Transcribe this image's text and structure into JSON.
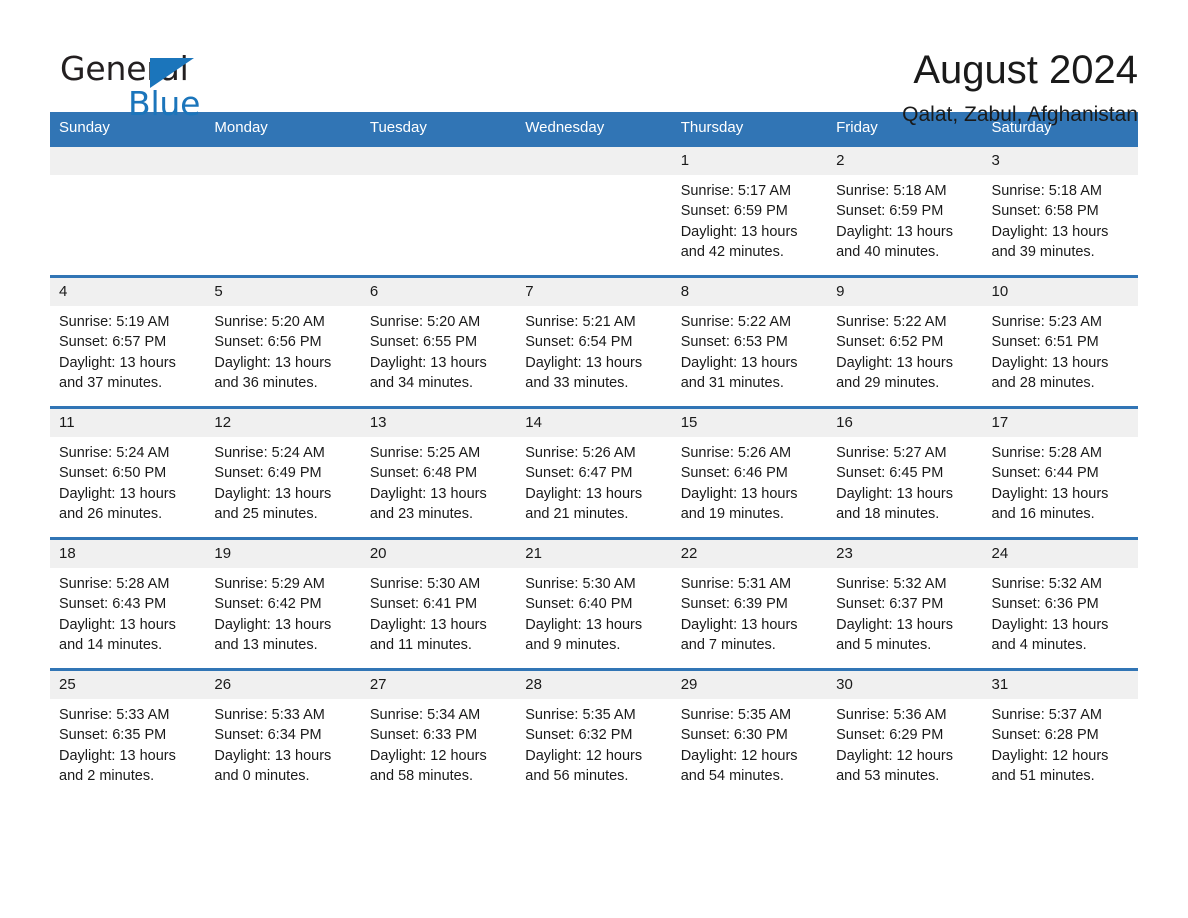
{
  "brand": {
    "name_part1": "General",
    "name_part2": "Blue",
    "accent_color": "#1b75bb"
  },
  "header": {
    "title": "August 2024",
    "location": "Qalat, Zabul, Afghanistan"
  },
  "theme": {
    "header_blue": "#3175b5",
    "date_strip_gray": "#f0f0f0",
    "text_color": "#1a1a1a"
  },
  "weekdays": [
    "Sunday",
    "Monday",
    "Tuesday",
    "Wednesday",
    "Thursday",
    "Friday",
    "Saturday"
  ],
  "weeks": [
    [
      {
        "empty": true
      },
      {
        "empty": true
      },
      {
        "empty": true
      },
      {
        "empty": true
      },
      {
        "day": "1",
        "sunrise": "Sunrise: 5:17 AM",
        "sunset": "Sunset: 6:59 PM",
        "daylight_line1": "Daylight: 13 hours",
        "daylight_line2": "and 42 minutes."
      },
      {
        "day": "2",
        "sunrise": "Sunrise: 5:18 AM",
        "sunset": "Sunset: 6:59 PM",
        "daylight_line1": "Daylight: 13 hours",
        "daylight_line2": "and 40 minutes."
      },
      {
        "day": "3",
        "sunrise": "Sunrise: 5:18 AM",
        "sunset": "Sunset: 6:58 PM",
        "daylight_line1": "Daylight: 13 hours",
        "daylight_line2": "and 39 minutes."
      }
    ],
    [
      {
        "day": "4",
        "sunrise": "Sunrise: 5:19 AM",
        "sunset": "Sunset: 6:57 PM",
        "daylight_line1": "Daylight: 13 hours",
        "daylight_line2": "and 37 minutes."
      },
      {
        "day": "5",
        "sunrise": "Sunrise: 5:20 AM",
        "sunset": "Sunset: 6:56 PM",
        "daylight_line1": "Daylight: 13 hours",
        "daylight_line2": "and 36 minutes."
      },
      {
        "day": "6",
        "sunrise": "Sunrise: 5:20 AM",
        "sunset": "Sunset: 6:55 PM",
        "daylight_line1": "Daylight: 13 hours",
        "daylight_line2": "and 34 minutes."
      },
      {
        "day": "7",
        "sunrise": "Sunrise: 5:21 AM",
        "sunset": "Sunset: 6:54 PM",
        "daylight_line1": "Daylight: 13 hours",
        "daylight_line2": "and 33 minutes."
      },
      {
        "day": "8",
        "sunrise": "Sunrise: 5:22 AM",
        "sunset": "Sunset: 6:53 PM",
        "daylight_line1": "Daylight: 13 hours",
        "daylight_line2": "and 31 minutes."
      },
      {
        "day": "9",
        "sunrise": "Sunrise: 5:22 AM",
        "sunset": "Sunset: 6:52 PM",
        "daylight_line1": "Daylight: 13 hours",
        "daylight_line2": "and 29 minutes."
      },
      {
        "day": "10",
        "sunrise": "Sunrise: 5:23 AM",
        "sunset": "Sunset: 6:51 PM",
        "daylight_line1": "Daylight: 13 hours",
        "daylight_line2": "and 28 minutes."
      }
    ],
    [
      {
        "day": "11",
        "sunrise": "Sunrise: 5:24 AM",
        "sunset": "Sunset: 6:50 PM",
        "daylight_line1": "Daylight: 13 hours",
        "daylight_line2": "and 26 minutes."
      },
      {
        "day": "12",
        "sunrise": "Sunrise: 5:24 AM",
        "sunset": "Sunset: 6:49 PM",
        "daylight_line1": "Daylight: 13 hours",
        "daylight_line2": "and 25 minutes."
      },
      {
        "day": "13",
        "sunrise": "Sunrise: 5:25 AM",
        "sunset": "Sunset: 6:48 PM",
        "daylight_line1": "Daylight: 13 hours",
        "daylight_line2": "and 23 minutes."
      },
      {
        "day": "14",
        "sunrise": "Sunrise: 5:26 AM",
        "sunset": "Sunset: 6:47 PM",
        "daylight_line1": "Daylight: 13 hours",
        "daylight_line2": "and 21 minutes."
      },
      {
        "day": "15",
        "sunrise": "Sunrise: 5:26 AM",
        "sunset": "Sunset: 6:46 PM",
        "daylight_line1": "Daylight: 13 hours",
        "daylight_line2": "and 19 minutes."
      },
      {
        "day": "16",
        "sunrise": "Sunrise: 5:27 AM",
        "sunset": "Sunset: 6:45 PM",
        "daylight_line1": "Daylight: 13 hours",
        "daylight_line2": "and 18 minutes."
      },
      {
        "day": "17",
        "sunrise": "Sunrise: 5:28 AM",
        "sunset": "Sunset: 6:44 PM",
        "daylight_line1": "Daylight: 13 hours",
        "daylight_line2": "and 16 minutes."
      }
    ],
    [
      {
        "day": "18",
        "sunrise": "Sunrise: 5:28 AM",
        "sunset": "Sunset: 6:43 PM",
        "daylight_line1": "Daylight: 13 hours",
        "daylight_line2": "and 14 minutes."
      },
      {
        "day": "19",
        "sunrise": "Sunrise: 5:29 AM",
        "sunset": "Sunset: 6:42 PM",
        "daylight_line1": "Daylight: 13 hours",
        "daylight_line2": "and 13 minutes."
      },
      {
        "day": "20",
        "sunrise": "Sunrise: 5:30 AM",
        "sunset": "Sunset: 6:41 PM",
        "daylight_line1": "Daylight: 13 hours",
        "daylight_line2": "and 11 minutes."
      },
      {
        "day": "21",
        "sunrise": "Sunrise: 5:30 AM",
        "sunset": "Sunset: 6:40 PM",
        "daylight_line1": "Daylight: 13 hours",
        "daylight_line2": "and 9 minutes."
      },
      {
        "day": "22",
        "sunrise": "Sunrise: 5:31 AM",
        "sunset": "Sunset: 6:39 PM",
        "daylight_line1": "Daylight: 13 hours",
        "daylight_line2": "and 7 minutes."
      },
      {
        "day": "23",
        "sunrise": "Sunrise: 5:32 AM",
        "sunset": "Sunset: 6:37 PM",
        "daylight_line1": "Daylight: 13 hours",
        "daylight_line2": "and 5 minutes."
      },
      {
        "day": "24",
        "sunrise": "Sunrise: 5:32 AM",
        "sunset": "Sunset: 6:36 PM",
        "daylight_line1": "Daylight: 13 hours",
        "daylight_line2": "and 4 minutes."
      }
    ],
    [
      {
        "day": "25",
        "sunrise": "Sunrise: 5:33 AM",
        "sunset": "Sunset: 6:35 PM",
        "daylight_line1": "Daylight: 13 hours",
        "daylight_line2": "and 2 minutes."
      },
      {
        "day": "26",
        "sunrise": "Sunrise: 5:33 AM",
        "sunset": "Sunset: 6:34 PM",
        "daylight_line1": "Daylight: 13 hours",
        "daylight_line2": "and 0 minutes."
      },
      {
        "day": "27",
        "sunrise": "Sunrise: 5:34 AM",
        "sunset": "Sunset: 6:33 PM",
        "daylight_line1": "Daylight: 12 hours",
        "daylight_line2": "and 58 minutes."
      },
      {
        "day": "28",
        "sunrise": "Sunrise: 5:35 AM",
        "sunset": "Sunset: 6:32 PM",
        "daylight_line1": "Daylight: 12 hours",
        "daylight_line2": "and 56 minutes."
      },
      {
        "day": "29",
        "sunrise": "Sunrise: 5:35 AM",
        "sunset": "Sunset: 6:30 PM",
        "daylight_line1": "Daylight: 12 hours",
        "daylight_line2": "and 54 minutes."
      },
      {
        "day": "30",
        "sunrise": "Sunrise: 5:36 AM",
        "sunset": "Sunset: 6:29 PM",
        "daylight_line1": "Daylight: 12 hours",
        "daylight_line2": "and 53 minutes."
      },
      {
        "day": "31",
        "sunrise": "Sunrise: 5:37 AM",
        "sunset": "Sunset: 6:28 PM",
        "daylight_line1": "Daylight: 12 hours",
        "daylight_line2": "and 51 minutes."
      }
    ]
  ]
}
